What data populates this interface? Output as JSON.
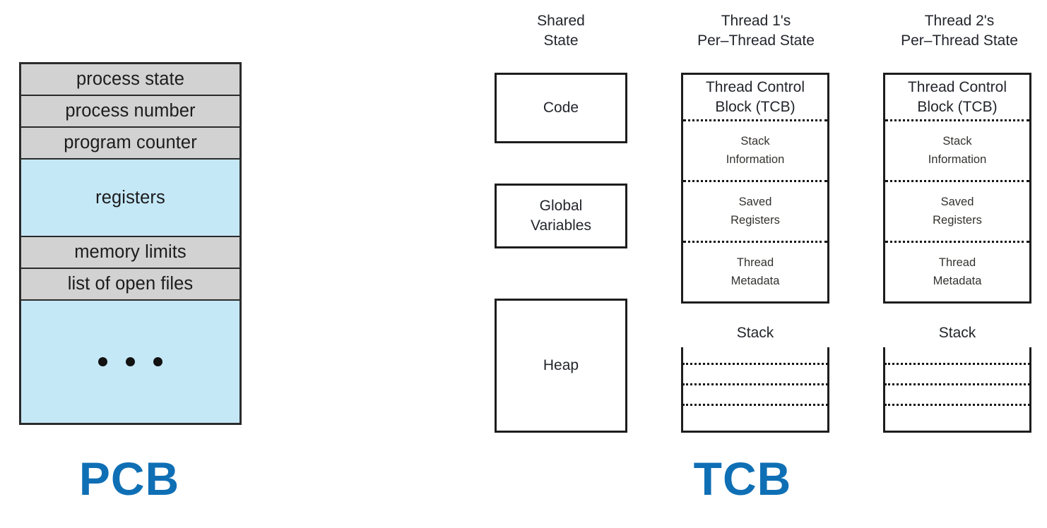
{
  "figure": {
    "left_caption": "PCB",
    "right_caption": "TCB",
    "accent_color": "#0f6fb5"
  },
  "pcb": {
    "rows": [
      {
        "label": "process state",
        "fill": "#d2d2d2",
        "kind": "text"
      },
      {
        "label": "process number",
        "fill": "#d2d2d2",
        "kind": "text"
      },
      {
        "label": "program counter",
        "fill": "#d2d2d2",
        "kind": "text"
      },
      {
        "label": "registers",
        "fill": "#c5e8f7",
        "kind": "text"
      },
      {
        "label": "memory limits",
        "fill": "#d2d2d2",
        "kind": "text"
      },
      {
        "label": "list of open files",
        "fill": "#d2d2d2",
        "kind": "text"
      },
      {
        "label": "• • •",
        "fill": "#c5e8f7",
        "kind": "dots"
      }
    ]
  },
  "columns": {
    "shared": {
      "header_line1": "Shared",
      "header_line2": "State",
      "boxes": [
        {
          "line1": "Code",
          "line2": ""
        },
        {
          "line1": "Global",
          "line2": "Variables"
        },
        {
          "line1": "Heap",
          "line2": ""
        }
      ]
    },
    "thread1": {
      "header_line1": "Thread 1's",
      "header_line2": "Per–Thread State",
      "tcb": {
        "title_line1": "Thread Control",
        "title_line2": "Block (TCB)",
        "sections": [
          {
            "line1": "Stack",
            "line2": "Information"
          },
          {
            "line1": "Saved",
            "line2": "Registers"
          },
          {
            "line1": "Thread",
            "line2": "Metadata"
          }
        ]
      },
      "stack_label": "Stack",
      "stack_divider_count": 3
    },
    "thread2": {
      "header_line1": "Thread 2's",
      "header_line2": "Per–Thread State",
      "tcb": {
        "title_line1": "Thread Control",
        "title_line2": "Block (TCB)",
        "sections": [
          {
            "line1": "Stack",
            "line2": "Information"
          },
          {
            "line1": "Saved",
            "line2": "Registers"
          },
          {
            "line1": "Thread",
            "line2": "Metadata"
          }
        ]
      },
      "stack_label": "Stack",
      "stack_divider_count": 3
    }
  }
}
